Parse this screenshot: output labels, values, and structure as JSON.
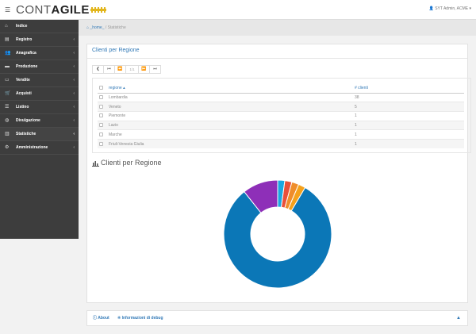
{
  "header": {
    "logo_thin": "CONT",
    "logo_bold": "AGILE",
    "user": "SYT Admin, ACME"
  },
  "sidebar": {
    "items": [
      {
        "label": "Indice",
        "icon": "home-icon",
        "has_chevron": false
      },
      {
        "label": "Registro",
        "icon": "book-icon",
        "has_chevron": true
      },
      {
        "label": "Anagrafica",
        "icon": "users-icon",
        "has_chevron": true
      },
      {
        "label": "Produzione",
        "icon": "truck-icon",
        "has_chevron": true
      },
      {
        "label": "Vendite",
        "icon": "money-icon",
        "has_chevron": true
      },
      {
        "label": "Acquisti",
        "icon": "cart-icon",
        "has_chevron": true
      },
      {
        "label": "Listino",
        "icon": "list-icon",
        "has_chevron": true
      },
      {
        "label": "Divulgazione",
        "icon": "globe-icon",
        "has_chevron": true
      },
      {
        "label": "Statistiche",
        "icon": "bar-chart-icon",
        "has_chevron": true,
        "active": true
      },
      {
        "label": "Amministrazione",
        "icon": "gear-icon",
        "has_chevron": true
      }
    ]
  },
  "breadcrumb": {
    "home": "_home_",
    "separator": "/",
    "current": "Statistiche"
  },
  "panel": {
    "title": "Clienti per Regione",
    "pager": {
      "page_info": "1/1"
    },
    "table": {
      "columns": [
        "regione ▴",
        "# clienti"
      ],
      "rows": [
        [
          "Lombardia",
          "38"
        ],
        [
          "Veneto",
          "5"
        ],
        [
          "Piemonte",
          "1"
        ],
        [
          "Lazio",
          "1"
        ],
        [
          "Marche",
          "1"
        ],
        [
          "Friuli-Venezia Giulia",
          "1"
        ]
      ]
    },
    "chart_title": "Clienti per Regione"
  },
  "chart_data": {
    "type": "pie",
    "donut": true,
    "categories": [
      "Lombardia",
      "Veneto",
      "Piemonte",
      "Lazio",
      "Marche",
      "Friuli-Venezia Giulia"
    ],
    "values": [
      38,
      5,
      1,
      1,
      1,
      1
    ],
    "colors": [
      "#0b77b7",
      "#8e2fb8",
      "#1ba8e0",
      "#e8503a",
      "#ef8d2b",
      "#f4a11c"
    ],
    "title": "Clienti per Regione"
  },
  "footer": {
    "about": "About",
    "debug": "Informazioni di debug"
  }
}
